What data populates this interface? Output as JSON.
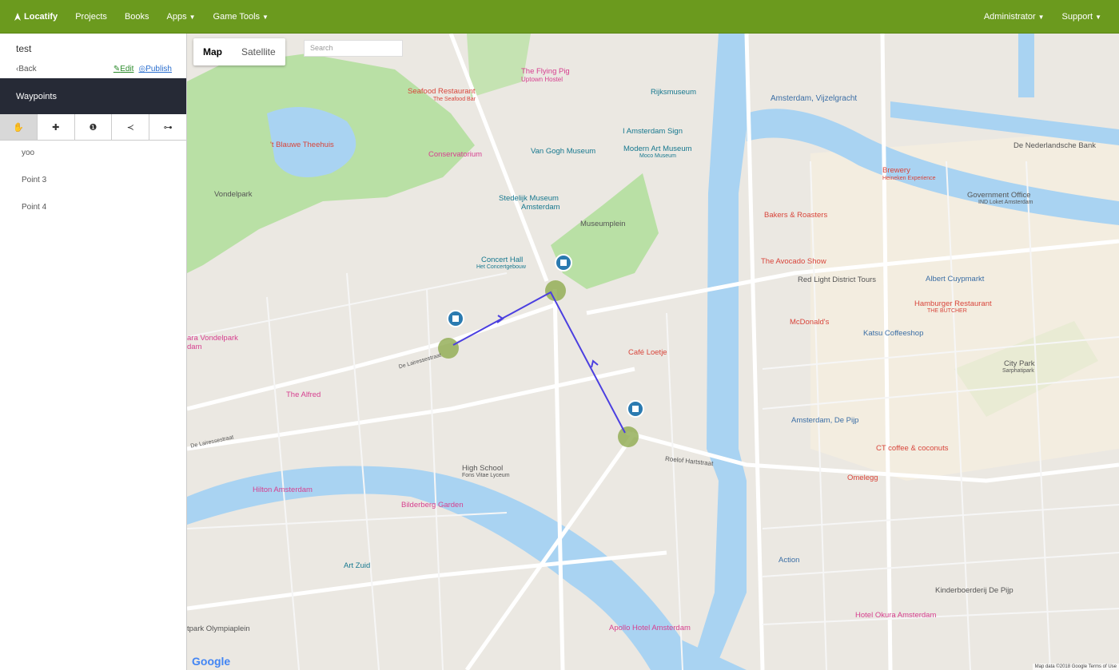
{
  "nav": {
    "brand": "Locatify",
    "items": [
      "Projects",
      "Books",
      "Apps",
      "Game Tools"
    ],
    "right": [
      "Administrator",
      "Support"
    ]
  },
  "sidebar": {
    "title": "test",
    "back": "Back",
    "edit": "Edit",
    "publish": "Publish",
    "section": "Waypoints",
    "waypoints": [
      "yoo",
      "Point 3",
      "Point 4"
    ]
  },
  "map": {
    "type_map": "Map",
    "type_satellite": "Satellite",
    "search_placeholder": "Search",
    "google": "Google",
    "attribution": "Map data ©2018 Google   Terms of Use"
  },
  "labels": {
    "flying_pig": "The Flying Pig",
    "flying_pig2": "Uptown Hostel",
    "seafood": "Seafood Restaurant",
    "seafood2": "The Seafood Bar",
    "rijks": "Rijksmuseum",
    "vizel": "Amsterdam, Vijzelgracht",
    "iam_sign": "I Amsterdam Sign",
    "blauwe": "'t Blauwe Theehuis",
    "conservatorium": "Conservatorium",
    "van_gogh": "Van Gogh Museum",
    "modern_art": "Modern Art Museum",
    "moco": "Moco Museum",
    "nederlandsche": "De Nederlandsche Bank",
    "brewery": "Brewery",
    "heineken": "Heineken Experience",
    "gov_office": "Government Office",
    "gov_office2": "IND Loket Amsterdam",
    "vondelpark": "Vondelpark",
    "stedelijk": "Stedelijk Museum",
    "stedelijk2": "Amsterdam",
    "museumplein": "Museumplein",
    "bakers": "Bakers & Roasters",
    "avocado": "The Avocado Show",
    "concert": "Concert Hall",
    "concert2": "Het Concertgebouw",
    "red_light": "Red Light District Tours",
    "cuyp": "Albert Cuypmarkt",
    "hamburger": "Hamburger Restaurant",
    "butcher": "THE BUTCHER",
    "mcd": "McDonald's",
    "katsu": "Katsu Coffeeshop",
    "vondel_hotel": "ara Vondelpark",
    "vondel_hotel2": "dam",
    "loetje": "Café Loetje",
    "citypark": "City Park",
    "sarphati": "Sarphatipark",
    "alfred": "The Alfred",
    "depijp": "Amsterdam, De Pijp",
    "ct_coffee": "CT coffee & coconuts",
    "highschool": "High School",
    "highschool2": "Fons Vitae Lyceum",
    "hilton": "Hilton Amsterdam",
    "omelegg": "Omelegg",
    "bilderberg": "Bilderberg Garden",
    "action": "Action",
    "art_zuid": "Art Zuid",
    "kinder": "Kinderboerderij De Pijp",
    "okura": "Hotel Okura Amsterdam",
    "apollo": "Apollo Hotel Amsterdam",
    "olympia": "tpark Olympiaplein",
    "roelof": "Roelof Hartstraat",
    "lairesse": "De Lairessestraat",
    "lairesse2": "De Lairessestraat"
  },
  "colors": {
    "nav_green": "#6b9a1e",
    "dark_band": "#262a36",
    "route": "#4b3fe0",
    "water": "#a9d3f2",
    "park": "#b9e0a5"
  }
}
